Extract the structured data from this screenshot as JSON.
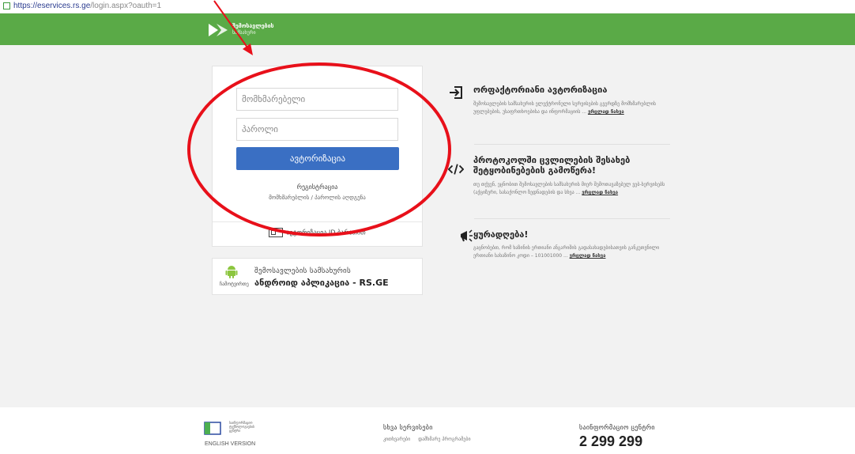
{
  "browser": {
    "url_host": "https://eservices.rs.ge",
    "url_path": "/login.aspx?oauth=1"
  },
  "header": {
    "brand_name": "შემოსავლების",
    "brand_sub": "სამსახური"
  },
  "login": {
    "username_placeholder": "მომხმარებელი",
    "password_placeholder": "პაროლი",
    "login_button": "ავტორიზაცია",
    "register_link": "რეგისტრაცია",
    "recover_link": "მომხმარებლის / პაროლის აღდგენა",
    "id_card_login": "ავტორიზაცია ID ბარათით"
  },
  "android": {
    "download": "ჩამოტვირთე",
    "line1": "შემოსავლების სამსახურის",
    "line2": "ანდროიდ აპლიკაცია - RS.GE"
  },
  "news": [
    {
      "icon": "sign-in-icon",
      "title": "ორფაქტორიანი ავტორიზაცია",
      "body": "შემოსავლების სამსახურის ელექტრონული სერვისების გვერდზე მომხმარებლის უფლებების, უსაფრთხოებისა და ინფორმაციის ...",
      "more": "ვრცლად ნახვა"
    },
    {
      "icon": "code-icon",
      "title": "პროტოკოლში ცვლილების შესახებ შეტყობინებების გამოწერა!",
      "body": "თუ თქვენ, ეცნობით შემოსავლების სამსახურის მიერ შემოთავაზებულ ვებ-სერვისებს (აქციზური, სასაქონლო ზედნადების და სხვა ...",
      "more": "ვრცლად ნახვა"
    },
    {
      "icon": "megaphone-icon",
      "title": "ყურადღება!",
      "body": "გაცნობებთ, რომ ხაზინის ერთიანი ანგარიშის გადასახადებისათვის განკუთვნილი ერთიანი სახაზინო კოდი – 101001000 ...",
      "more": "ვრცლად ნახვა"
    }
  ],
  "footer": {
    "logo_text_1": "საინფორმაციო",
    "logo_text_2": "ტექნოლოგიების",
    "logo_text_3": "ცენტრი",
    "english": "ENGLISH VERSION",
    "services_title": "სხვა სერვისები",
    "service_links": [
      "კითხვარები",
      "დამხმარე პროგრამები"
    ],
    "info_center": "საინფორმაციო ცენტრი",
    "phone": "2 299 299"
  },
  "colors": {
    "header_green": "#5aaa47",
    "button_blue": "#3a6fc3",
    "annotation_red": "#e8101a"
  }
}
